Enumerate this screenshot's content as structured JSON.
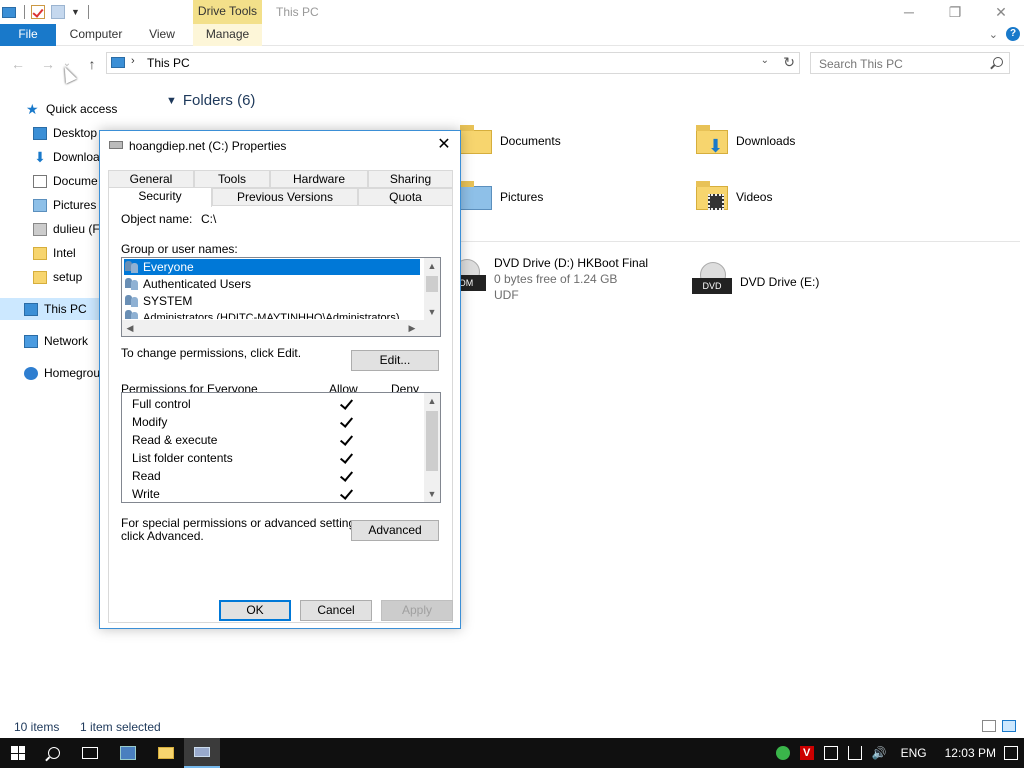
{
  "window": {
    "title": "This PC",
    "context_tab": "Drive Tools",
    "controls": {
      "minimize": "─",
      "maximize": "❐",
      "close": "✕"
    }
  },
  "ribbon": {
    "tabs": {
      "file": "File",
      "computer": "Computer",
      "view": "View",
      "manage": "Manage"
    },
    "expand": "⌄",
    "help": "?"
  },
  "address": {
    "path": "This PC",
    "separator": "›",
    "search_placeholder": "Search This PC"
  },
  "nav_arrows": {
    "back": "←",
    "forward": "→",
    "recent": "⌄",
    "up": "↑",
    "dropdown": "⌄",
    "refresh": "↻"
  },
  "sidebar": {
    "items": [
      {
        "label": "Quick access",
        "icon": "star-icon"
      },
      {
        "label": "Desktop",
        "icon": "desktop-icon"
      },
      {
        "label": "Downloa",
        "icon": "download-icon"
      },
      {
        "label": "Docume",
        "icon": "documents-icon"
      },
      {
        "label": "Pictures",
        "icon": "pictures-icon"
      },
      {
        "label": "dulieu (F",
        "icon": "drive-icon"
      },
      {
        "label": "Intel",
        "icon": "folder-icon"
      },
      {
        "label": "setup",
        "icon": "folder-icon"
      },
      {
        "label": "This PC",
        "icon": "computer-icon"
      },
      {
        "label": "Network",
        "icon": "network-icon"
      },
      {
        "label": "Homegrou",
        "icon": "homegroup-icon"
      }
    ]
  },
  "content": {
    "folders_heading": "Folders (6)",
    "folders": [
      {
        "label": "Documents",
        "icon": "documents-folder-icon"
      },
      {
        "label": "Downloads",
        "icon": "downloads-folder-icon"
      },
      {
        "label": "Pictures",
        "icon": "pictures-folder-icon"
      },
      {
        "label": "Videos",
        "icon": "videos-folder-icon"
      }
    ],
    "drives": [
      {
        "label": "DVD Drive (D:) HKBoot Final",
        "line2": "0 bytes free of 1.24 GB",
        "line3": "UDF",
        "badge": "OM"
      },
      {
        "label": "DVD Drive (E:)",
        "badge": "DVD"
      }
    ]
  },
  "status": {
    "items_count": "10 items",
    "selection": "1 item selected"
  },
  "dialog": {
    "title": "hoangdiep.net (C:) Properties",
    "close": "✕",
    "tabs_row1": [
      "General",
      "Tools",
      "Hardware",
      "Sharing"
    ],
    "tabs_row2": [
      "Security",
      "Previous Versions",
      "Quota"
    ],
    "object_label": "Object name:",
    "object_value": "C:\\",
    "group_label": "Group or user names:",
    "users": [
      "Everyone",
      "Authenticated Users",
      "SYSTEM",
      "Administrators (HDITC-MAYTINHHO\\Administrators)"
    ],
    "change_text": "To change permissions, click Edit.",
    "edit_button": "Edit...",
    "perm_for": "Permissions for Everyone",
    "allow": "Allow",
    "deny": "Deny",
    "permissions": [
      {
        "name": "Full control",
        "allow": true,
        "deny": false
      },
      {
        "name": "Modify",
        "allow": true,
        "deny": false
      },
      {
        "name": "Read & execute",
        "allow": true,
        "deny": false
      },
      {
        "name": "List folder contents",
        "allow": true,
        "deny": false
      },
      {
        "name": "Read",
        "allow": true,
        "deny": false
      },
      {
        "name": "Write",
        "allow": true,
        "deny": false
      }
    ],
    "special_line1": "For special permissions or advanced settings,",
    "special_line2": "click Advanced.",
    "advanced_button": "Advanced",
    "ok": "OK",
    "cancel": "Cancel",
    "apply": "Apply",
    "scroll": {
      "up": "▲",
      "down": "▼",
      "left": "◀",
      "right": "▶"
    }
  },
  "taskbar": {
    "tray_v": "V",
    "volume": "🔊",
    "language": "ENG",
    "time": "12:03 PM"
  }
}
